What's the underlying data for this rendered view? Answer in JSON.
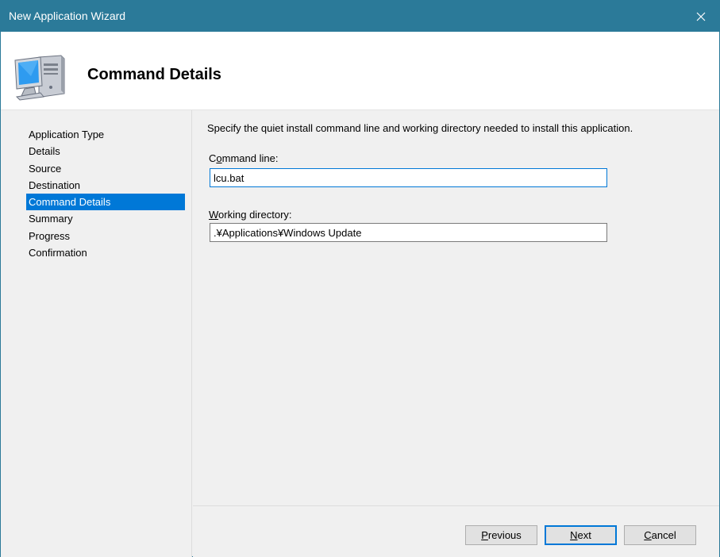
{
  "window": {
    "title": "New Application Wizard",
    "accent_color": "#2b7a99"
  },
  "header": {
    "heading": "Command Details",
    "icon": "computer-icon"
  },
  "sidebar": {
    "items": [
      {
        "label": "Application Type",
        "active": false
      },
      {
        "label": "Details",
        "active": false
      },
      {
        "label": "Source",
        "active": false
      },
      {
        "label": "Destination",
        "active": false
      },
      {
        "label": "Command Details",
        "active": true
      },
      {
        "label": "Summary",
        "active": false
      },
      {
        "label": "Progress",
        "active": false
      },
      {
        "label": "Confirmation",
        "active": false
      }
    ],
    "active_color": "#0078d7"
  },
  "content": {
    "description": "Specify the quiet install command line and working directory needed to install this application.",
    "command_line": {
      "label_prefix": "C",
      "label_accel": "o",
      "label_rest": "mmand line:",
      "value": "lcu.bat"
    },
    "working_directory": {
      "label_accel": "W",
      "label_rest": "orking directory:",
      "value": ".¥Applications¥Windows Update"
    }
  },
  "footer": {
    "previous": {
      "accel": "P",
      "rest": "revious"
    },
    "next": {
      "accel": "N",
      "rest": "ext"
    },
    "cancel": {
      "accel": "C",
      "rest": "ancel"
    }
  }
}
